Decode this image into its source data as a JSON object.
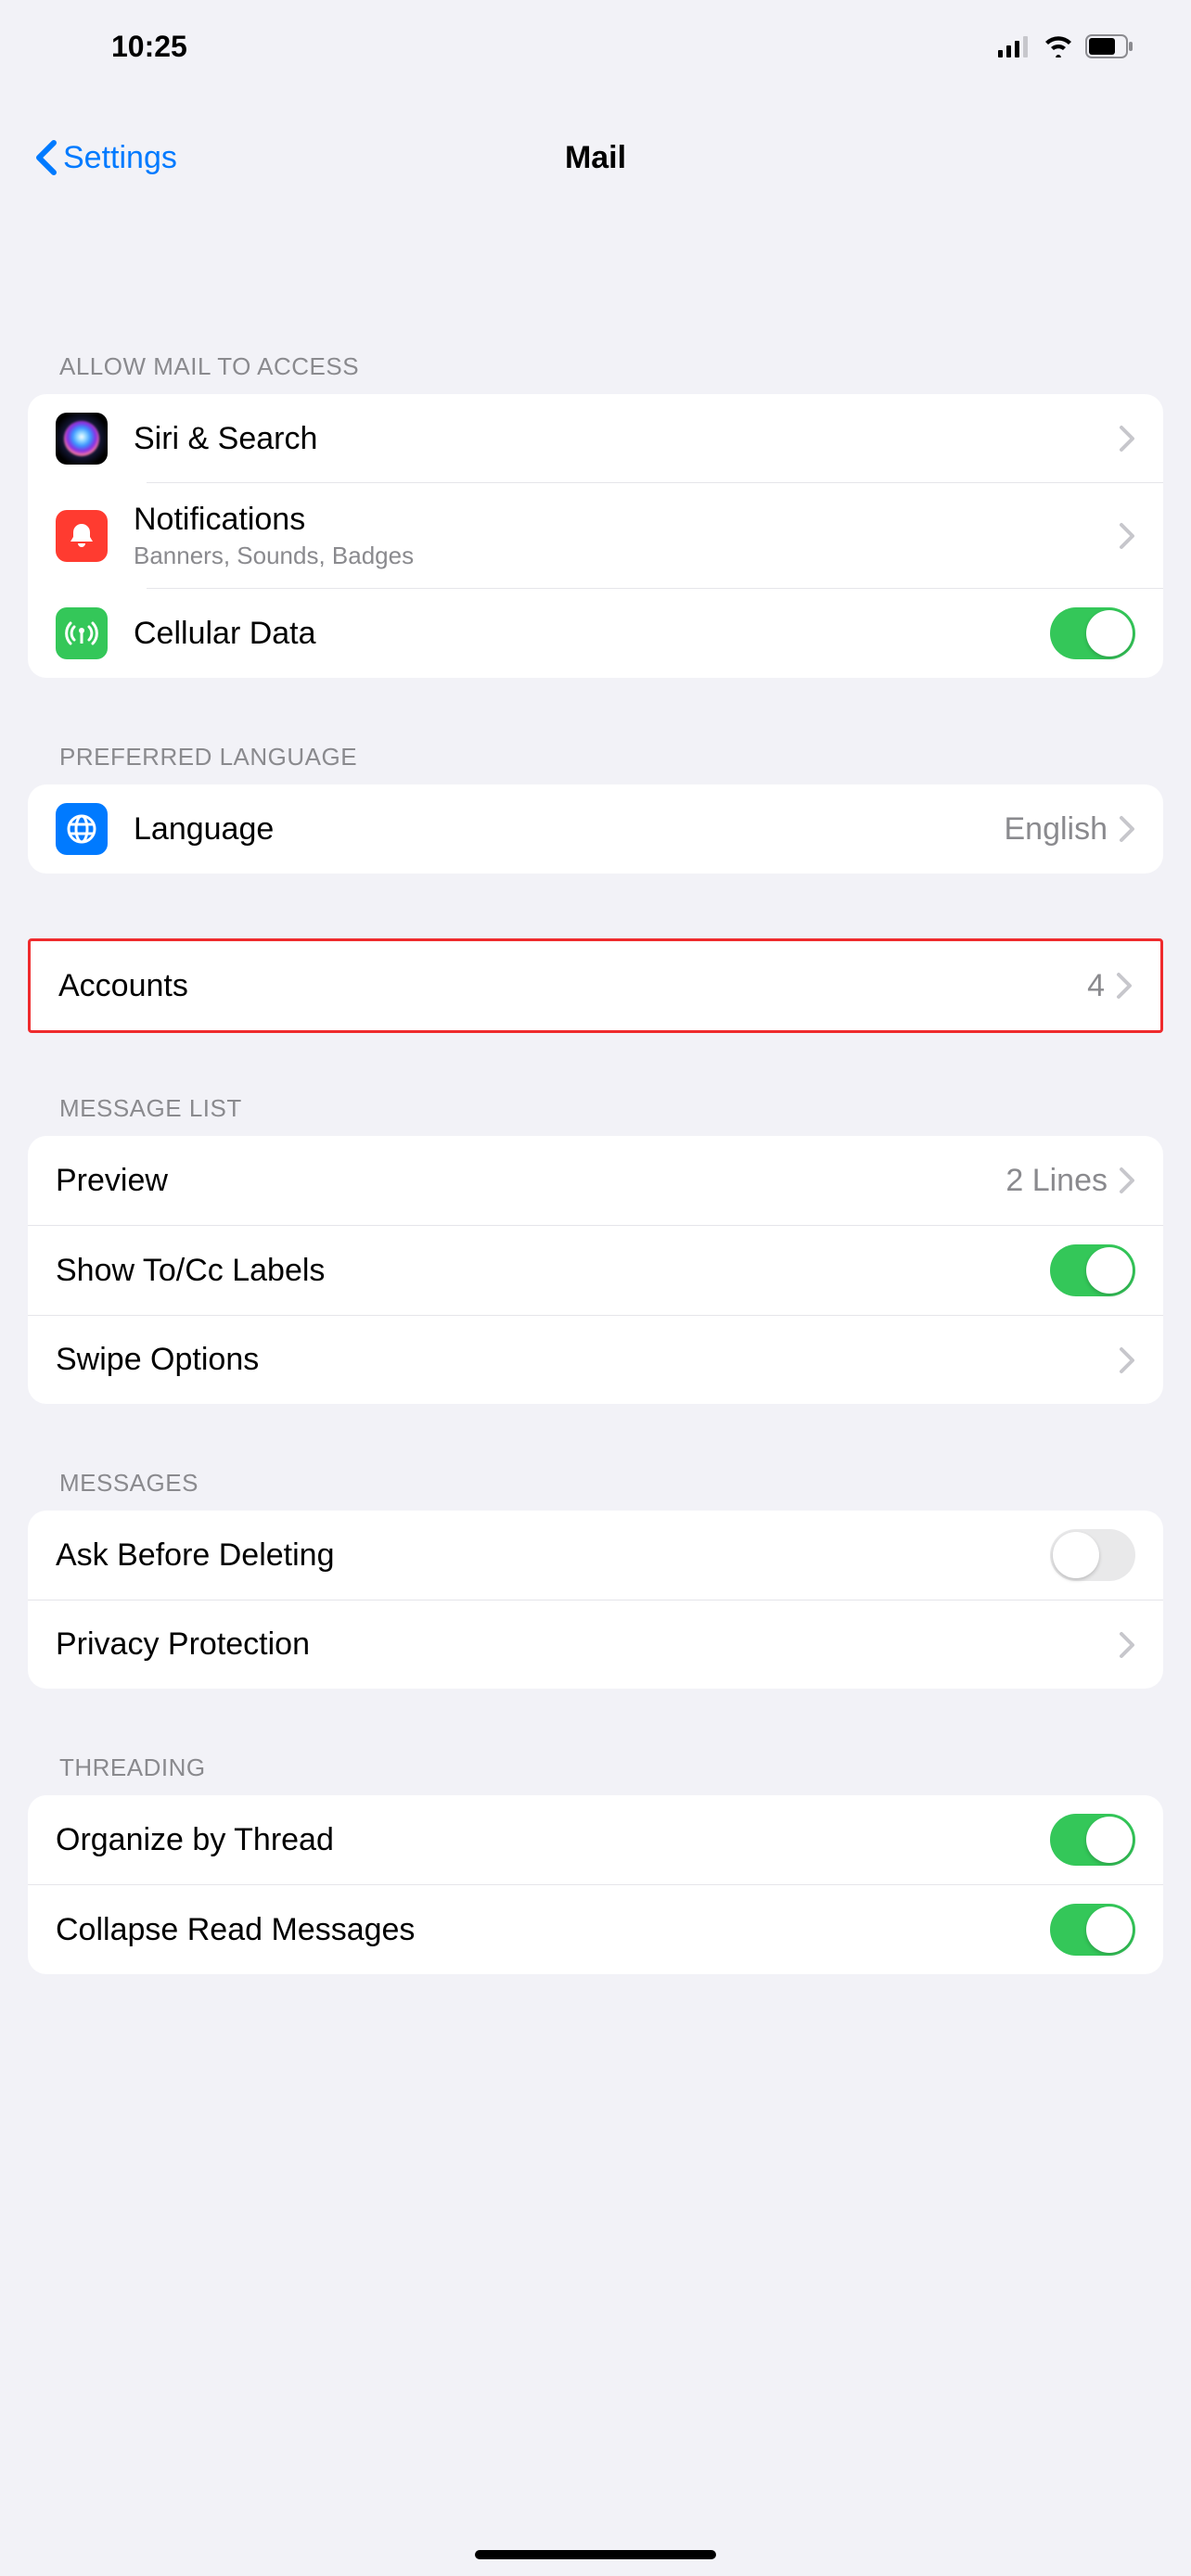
{
  "status": {
    "time": "10:25"
  },
  "nav": {
    "back_label": "Settings",
    "title": "Mail"
  },
  "sections": {
    "access": {
      "header": "Allow Mail to Access",
      "siri": "Siri & Search",
      "notifications": "Notifications",
      "notifications_sub": "Banners, Sounds, Badges",
      "cellular": "Cellular Data",
      "cellular_on": true
    },
    "language": {
      "header": "Preferred Language",
      "label": "Language",
      "value": "English"
    },
    "accounts": {
      "label": "Accounts",
      "value": "4"
    },
    "message_list": {
      "header": "Message List",
      "preview": "Preview",
      "preview_value": "2 Lines",
      "show_tocc": "Show To/Cc Labels",
      "show_tocc_on": true,
      "swipe": "Swipe Options"
    },
    "messages": {
      "header": "Messages",
      "ask_delete": "Ask Before Deleting",
      "ask_delete_on": false,
      "privacy": "Privacy Protection"
    },
    "threading": {
      "header": "Threading",
      "organize": "Organize by Thread",
      "organize_on": true,
      "collapse": "Collapse Read Messages",
      "collapse_on": true
    }
  }
}
